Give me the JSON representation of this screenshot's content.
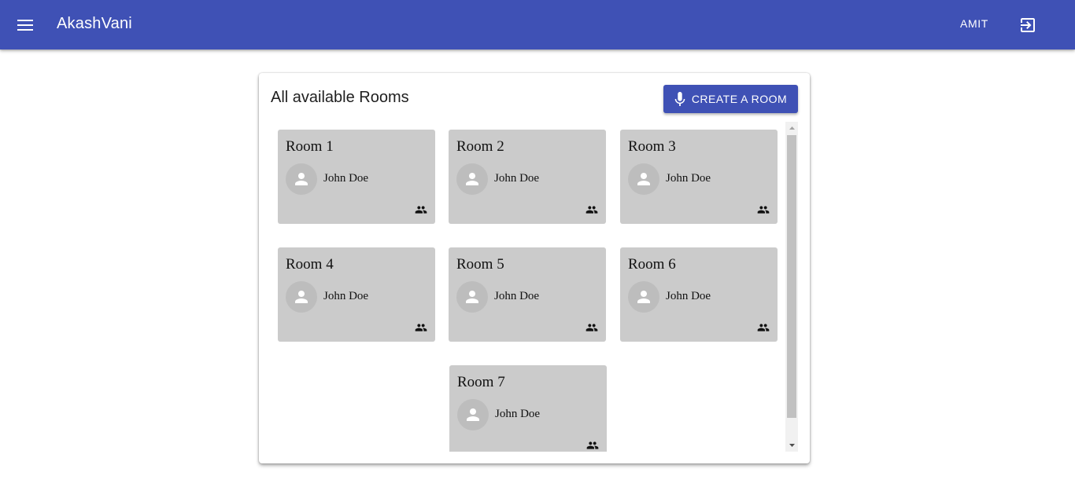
{
  "appbar": {
    "title": "AkashVani",
    "user": "AMIT",
    "menu_icon": "menu-icon",
    "logout_icon": "logout-icon",
    "color": "#3f51b5"
  },
  "panel": {
    "title": "All available Rooms",
    "create_button": "CREATE A ROOM"
  },
  "rooms": [
    {
      "name": "Room 1",
      "owner": "John Doe"
    },
    {
      "name": "Room 2",
      "owner": "John Doe"
    },
    {
      "name": "Room 3",
      "owner": "John Doe"
    },
    {
      "name": "Room 4",
      "owner": "John Doe"
    },
    {
      "name": "Room 5",
      "owner": "John Doe"
    },
    {
      "name": "Room 6",
      "owner": "John Doe"
    },
    {
      "name": "Room 7",
      "owner": "John Doe"
    }
  ],
  "colors": {
    "card": "#cbcbcb",
    "avatar": "#bdbdbd"
  }
}
